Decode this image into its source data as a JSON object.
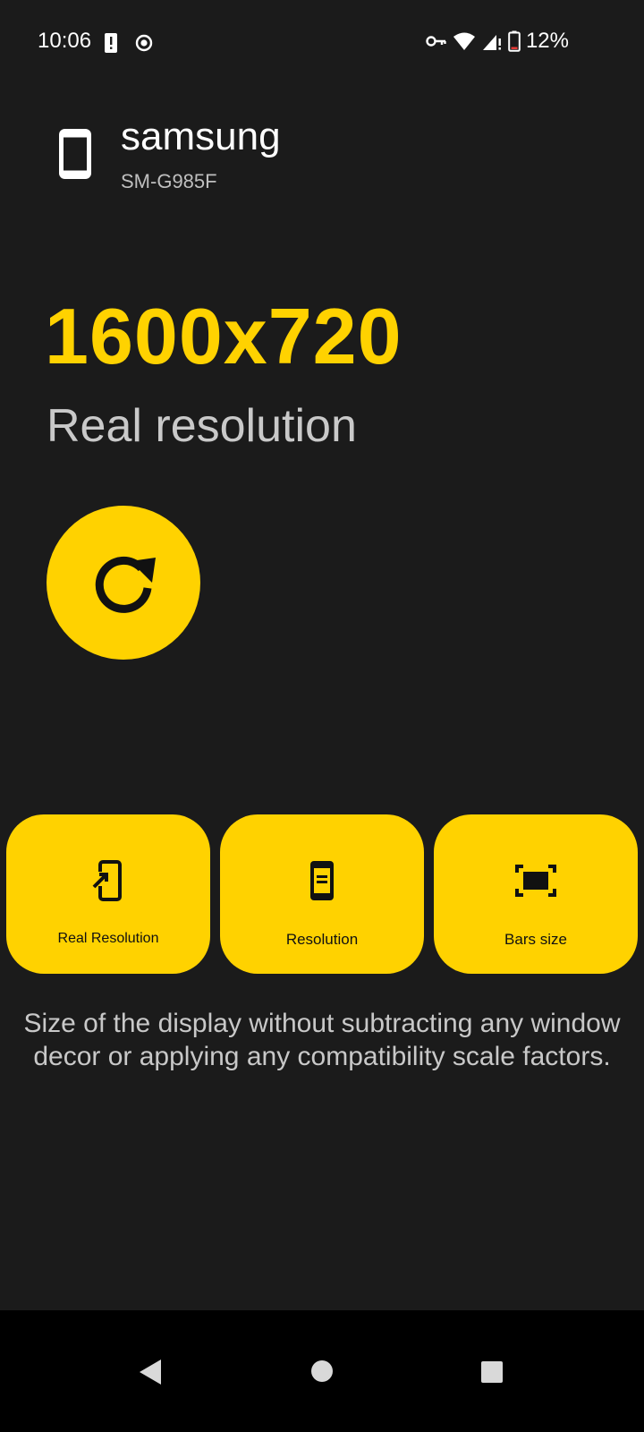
{
  "status_bar": {
    "time": "10:06",
    "battery_percent": "12%",
    "icons": [
      "alert-icon",
      "record-icon",
      "vpn-key-icon",
      "wifi-icon",
      "signal-icon",
      "battery-icon"
    ]
  },
  "device": {
    "brand": "samsung",
    "model": "SM-G985F",
    "icon": "phone-icon"
  },
  "main": {
    "value": "1600x720",
    "label": "Real resolution",
    "refresh_icon": "refresh-icon"
  },
  "cards": [
    {
      "label": "Real Resolution",
      "icon": "phone-link-icon"
    },
    {
      "label": "Resolution",
      "icon": "phone-document-icon"
    },
    {
      "label": "Bars size",
      "icon": "fullscreen-frame-icon"
    }
  ],
  "description": "Size of the display without subtracting any window decor or applying any compatibility scale factors.",
  "colors": {
    "accent": "#ffd200",
    "background": "#1b1b1b",
    "nav_bar": "#000000"
  },
  "nav": {
    "back": "back-icon",
    "home": "home-icon",
    "recents": "recents-icon"
  }
}
